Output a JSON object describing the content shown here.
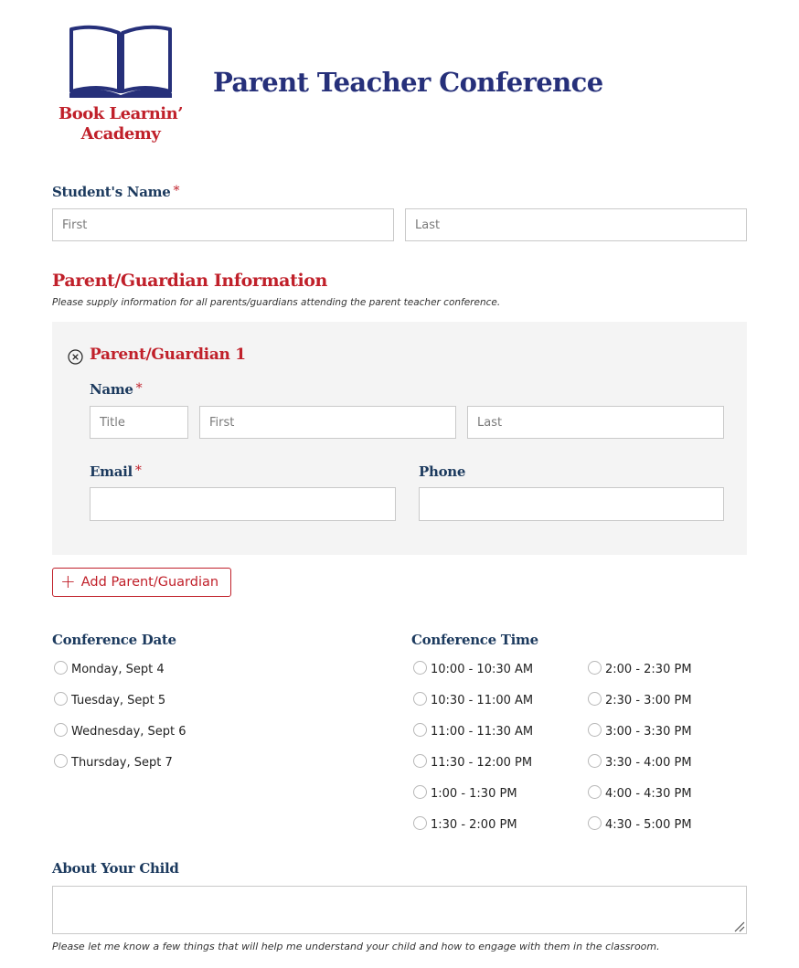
{
  "brand": {
    "logo_line1": "Book Learnin’",
    "logo_line2": "Academy",
    "colors": {
      "navy": "#26307a",
      "label_navy": "#1c3a5e",
      "red": "#c0202a",
      "panel_gray": "#f4f4f4",
      "border_gray": "#c9c9c9"
    }
  },
  "header": {
    "title": "Parent Teacher Conference"
  },
  "student_name": {
    "label": "Student's Name",
    "required_mark": "*",
    "first_placeholder": "First",
    "last_placeholder": "Last",
    "first_value": "",
    "last_value": ""
  },
  "guardian_section": {
    "title": "Parent/Guardian Information",
    "description": "Please supply information for all parents/guardians attending the parent teacher conference.",
    "guardians": [
      {
        "title": "Parent/Guardian 1",
        "remove_icon": "close-circle-icon",
        "name_label": "Name",
        "name_required_mark": "*",
        "title_placeholder": "Title",
        "first_placeholder": "First",
        "last_placeholder": "Last",
        "email_label": "Email",
        "email_required_mark": "*",
        "email_value": "",
        "phone_label": "Phone",
        "phone_value": ""
      }
    ],
    "add_button": {
      "icon": "plus-icon",
      "icon_glyph": "+",
      "label": "Add Parent/Guardian"
    }
  },
  "conference_date": {
    "label": "Conference Date",
    "options": [
      "Monday, Sept 4",
      "Tuesday, Sept 5",
      "Wednesday, Sept 6",
      "Thursday, Sept 7"
    ],
    "selected": null
  },
  "conference_time": {
    "label": "Conference Time",
    "options_col1": [
      "10:00 - 10:30 AM",
      "10:30 - 11:00 AM",
      "11:00 - 11:30 AM",
      "11:30 - 12:00 PM",
      "1:00 - 1:30 PM",
      "1:30 - 2:00 PM"
    ],
    "options_col2": [
      "2:00 - 2:30 PM",
      "2:30 - 3:00 PM",
      "3:00 - 3:30 PM",
      "3:30 - 4:00 PM",
      "4:00 - 4:30 PM",
      "4:30 - 5:00 PM"
    ],
    "selected": null
  },
  "about_child": {
    "label": "About Your Child",
    "value": "",
    "help_text": "Please let me know a few things that will help me understand your child and how to engage with them in the classroom."
  }
}
